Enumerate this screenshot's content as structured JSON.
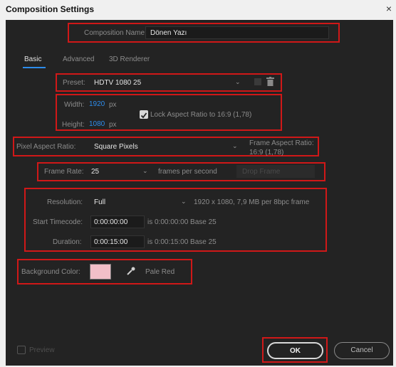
{
  "window": {
    "title": "Composition Settings",
    "close_glyph": "×"
  },
  "composition_name": {
    "label": "Composition Name:",
    "value": "Dönen Yazı"
  },
  "tabs": [
    {
      "label": "Basic"
    },
    {
      "label": "Advanced"
    },
    {
      "label": "3D Renderer"
    }
  ],
  "preset": {
    "label": "Preset:",
    "value": "HDTV 1080 25"
  },
  "dimensions": {
    "width_label": "Width:",
    "width_value": "1920",
    "width_unit": "px",
    "height_label": "Height:",
    "height_value": "1080",
    "height_unit": "px",
    "lock_label": "Lock Aspect Ratio to 16:9 (1,78)",
    "lock_checked": true
  },
  "pixel_aspect": {
    "label": "Pixel Aspect Ratio:",
    "value": "Square Pixels",
    "frame_aspect_label": "Frame Aspect Ratio:",
    "frame_aspect_value": "16:9 (1,78)"
  },
  "frame_rate": {
    "label": "Frame Rate:",
    "value": "25",
    "unit_label": "frames per second",
    "drop_frame_label": "Drop Frame"
  },
  "resolution": {
    "label": "Resolution:",
    "value": "Full",
    "info": "1920 x 1080, 7,9 MB per 8bpc frame"
  },
  "start_timecode": {
    "label": "Start Timecode:",
    "value": "0:00:00:00",
    "info": "is 0:00:00:00  Base 25"
  },
  "duration": {
    "label": "Duration:",
    "value": "0:00:15:00",
    "info": "is 0:00:15:00  Base 25"
  },
  "background_color": {
    "label": "Background Color:",
    "swatch_color": "#f2bfc8",
    "name": "Pale Red"
  },
  "footer": {
    "preview_label": "Preview",
    "ok_label": "OK",
    "cancel_label": "Cancel"
  },
  "colors": {
    "accent": "#2d8ceb",
    "highlight": "#d01818",
    "panel": "#232323"
  },
  "icons": [
    "close-icon",
    "chevron-down-icon",
    "save-preset-icon",
    "trash-icon",
    "checkbox-icon",
    "eyedropper-icon"
  ]
}
